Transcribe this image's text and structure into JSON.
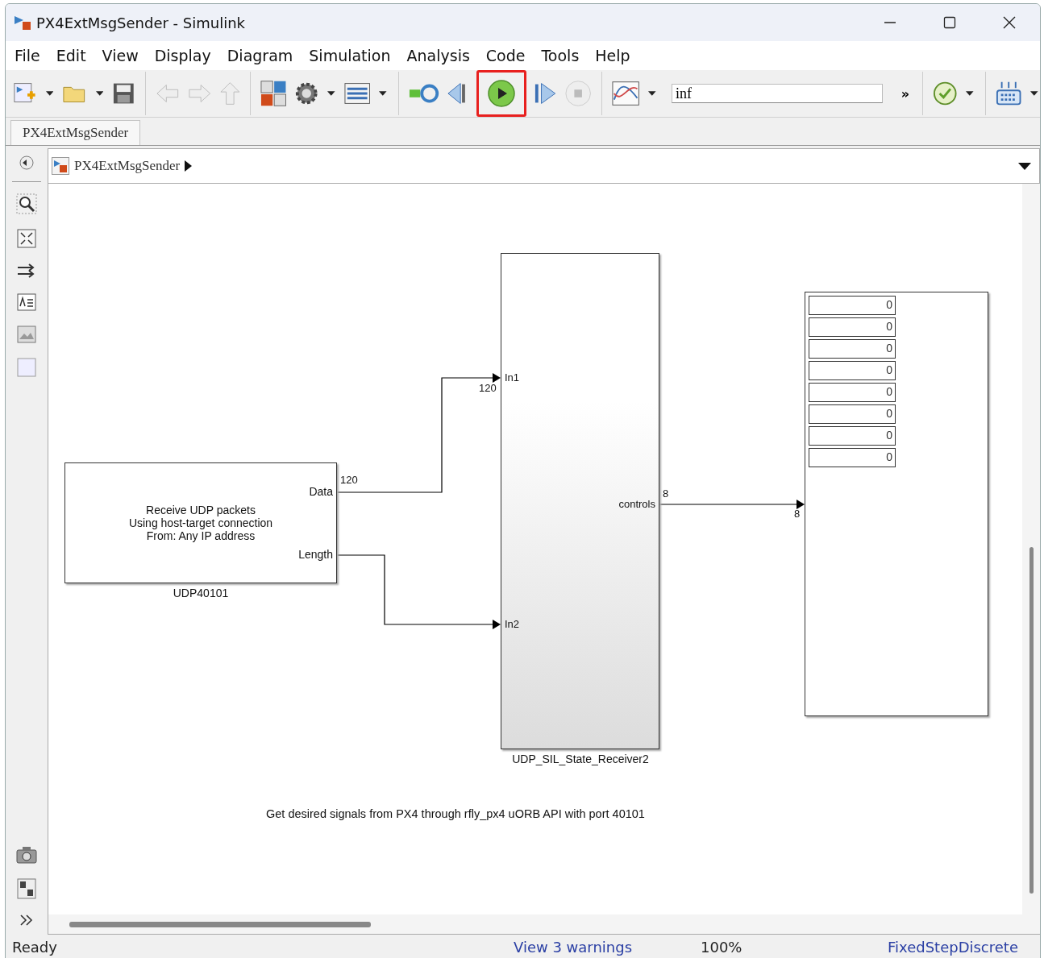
{
  "window": {
    "title": "PX4ExtMsgSender - Simulink"
  },
  "menu": [
    {
      "label": "File"
    },
    {
      "label": "Edit"
    },
    {
      "label": "View"
    },
    {
      "label": "Display"
    },
    {
      "label": "Diagram"
    },
    {
      "label": "Simulation"
    },
    {
      "label": "Analysis"
    },
    {
      "label": "Code"
    },
    {
      "label": "Tools"
    },
    {
      "label": "Help"
    }
  ],
  "toolbar": {
    "run_highlighted": true,
    "stop_time": "inf",
    "overflow": "»"
  },
  "tabs": [
    {
      "label": "PX4ExtMsgSender",
      "selected": true
    }
  ],
  "breadcrumb": {
    "path": "PX4ExtMsgSender"
  },
  "diagram": {
    "blocks": [
      {
        "kind": "udp",
        "name": "UDP40101",
        "text": [
          "Receive UDP packets",
          "Using host-target connection",
          "From: Any IP address"
        ],
        "outputs": [
          "Data",
          "Length"
        ]
      },
      {
        "kind": "subsystem",
        "name": "UDP_SIL_State_Receiver2",
        "inputs": [
          "In1",
          "In2"
        ],
        "outputs": [
          "controls"
        ]
      },
      {
        "kind": "display",
        "values": [
          "0",
          "0",
          "0",
          "0",
          "0",
          "0",
          "0",
          "0"
        ]
      }
    ],
    "signals": [
      {
        "label": "120"
      },
      {
        "label": "120"
      },
      {
        "label": "8"
      },
      {
        "label": "8"
      }
    ],
    "annotation": "Get desired signals from PX4 through rfly_px4 uORB API with port 40101"
  },
  "status_bar": {
    "state": "Ready",
    "warnings": "View 3 warnings",
    "zoom": "100%",
    "solver": "FixedStepDiscrete"
  }
}
